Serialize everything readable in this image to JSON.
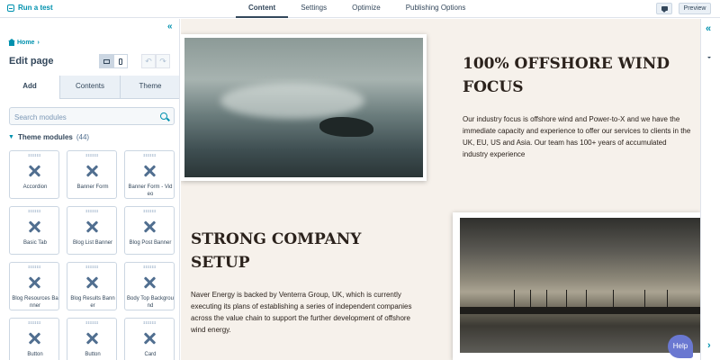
{
  "topbar": {
    "run_test": "Run a test",
    "tabs": [
      "Content",
      "Settings",
      "Optimize",
      "Publishing Options"
    ],
    "active_tab": "Content",
    "preview": "Preview"
  },
  "left_panel": {
    "breadcrumb": "Home",
    "title": "Edit page",
    "tabs": [
      "Add",
      "Contents",
      "Theme"
    ],
    "active_tab": "Add",
    "search_placeholder": "Search modules",
    "section_title": "Theme modules",
    "section_count": "(44)",
    "modules": [
      "Accordion",
      "Banner Form",
      "Banner Form - Video",
      "Basic Tab",
      "Blog List Banner",
      "Blog Post Banner",
      "Blog Resources Banner",
      "Blog Results Banner",
      "Body Top Background",
      "Button",
      "Button",
      "Card"
    ]
  },
  "canvas": {
    "heading1": "100% OFFSHORE WIND FOCUS",
    "paragraph1": "Our industry focus is offshore wind and Power-to-X and we have the immediate capacity and experience to offer our services to clients in the UK, EU, US and Asia. Our team has 100+ years of accumulated industry experience",
    "heading2": "STRONG COMPANY SETUP",
    "paragraph2": "Naver Energy is backed by Venterra Group, UK, which is currently executing its plans of establishing a series of independent companies across the value chain to support the further development of offshore wind energy."
  },
  "help": "Help",
  "colors": {
    "accent": "#0091ae",
    "text": "#33475b",
    "canvas_bg": "#f6f1eb",
    "heading": "#2b221c"
  },
  "icons": [
    "flask-icon",
    "comment-icon",
    "collapse-icon",
    "home-icon",
    "desktop-icon",
    "mobile-icon",
    "undo-icon",
    "redo-icon",
    "search-icon",
    "wrench-icon",
    "chat-icon",
    "chevron-right-icon"
  ]
}
